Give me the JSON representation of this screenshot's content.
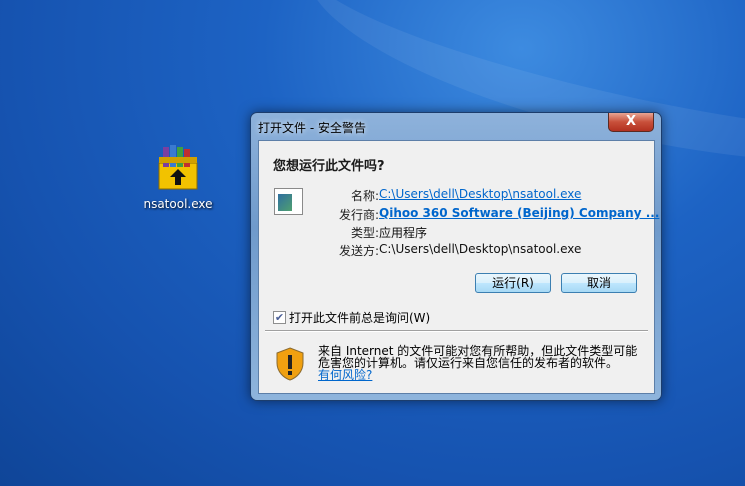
{
  "desktop": {
    "icon_label": "nsatool.exe",
    "icon": "winrar-archive-icon"
  },
  "dialog": {
    "title": "打开文件 - 安全警告",
    "close_label": "X",
    "question": "您想运行此文件吗?",
    "fields": [
      {
        "key": "名称:",
        "value": "C:\\Users\\dell\\Desktop\\nsatool.exe"
      },
      {
        "key": "发行商:",
        "value": "Qihoo 360 Software (Beijing) Company ..."
      },
      {
        "key": "类型:",
        "value": "应用程序"
      },
      {
        "key": "发送方:",
        "value": "C:\\Users\\dell\\Desktop\\nsatool.exe"
      }
    ],
    "run_label": "运行(R)",
    "cancel_label": "取消",
    "checkbox_label": "打开此文件前总是询问(W)",
    "checkbox_checked": true,
    "warning_text": "来自 Internet 的文件可能对您有所帮助，但此文件类型可能危害您的计算机。请仅运行来自您信任的发布者的软件。",
    "risk_link": "有何风险?"
  }
}
